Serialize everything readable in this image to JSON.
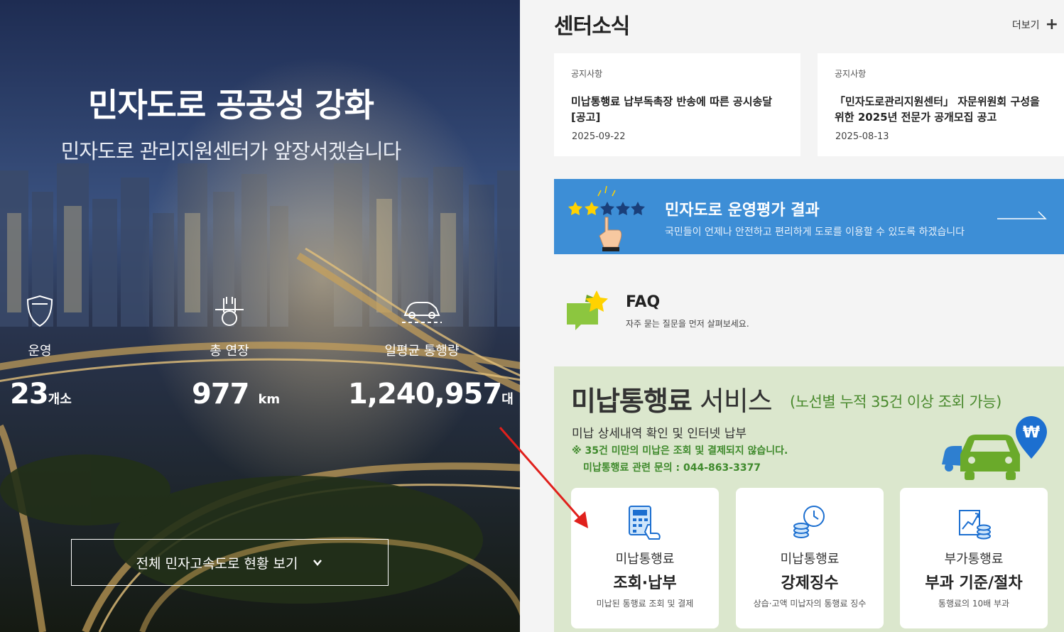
{
  "hero": {
    "title": "민자도로 공공성 강화",
    "subtitle": "민자도로 관리지원센터가 앞장서겠습니다",
    "stats": [
      {
        "icon": "shield-icon",
        "label": "운영",
        "value": "23",
        "unit": "개소"
      },
      {
        "icon": "road-icon",
        "label": "총 연장",
        "value": "977",
        "unit": "km"
      },
      {
        "icon": "car-icon",
        "label": "일평균 통행량",
        "value": "1,240,957",
        "unit": "대"
      }
    ],
    "all_button": "전체 민자고속도로 현황 보기"
  },
  "news": {
    "title": "센터소식",
    "more": "더보기",
    "items": [
      {
        "category": "공지사항",
        "title": "미납통행료 납부독촉장 반송에 따른 공시송달[공고]",
        "date": "2025-09-22"
      },
      {
        "category": "공지사항",
        "title": "「민자도로관리지원센터」 자문위원회 구성을 위한 2025년 전문가 공개모집 공고",
        "date": "2025-08-13"
      }
    ]
  },
  "evaluation": {
    "title": "민자도로 운영평가 결과",
    "subtitle": "국민들이 언제나 안전하고 편리하게 도로를 이용할 수 있도록 하겠습니다"
  },
  "faq": {
    "title": "FAQ",
    "subtitle": "자주 묻는 질문을 먼저 살펴보세요."
  },
  "service": {
    "title_bold": "미납통행료",
    "title_rest": " 서비스",
    "note": "(노선별 누적 35건 이상 조회 가능)",
    "desc": "미납 상세내역 확인 및 인터넷 납부",
    "warn1": "※ 35건 미만의 미납은 조회 및 결제되지 않습니다.",
    "warn2": "미납통행료 관련 문의 : 044-863-3377",
    "pin_symbol": "₩",
    "tiles": [
      {
        "line1": "미납통행료",
        "line2": "조회·납부",
        "line3": "미납된 통행료 조회 및 결제"
      },
      {
        "line1": "미납통행료",
        "line2": "강제징수",
        "line3": "상습·고액 미납자의 통행료 징수"
      },
      {
        "line1": "부가통행료",
        "line2": "부과 기준/절차",
        "line3": "통행료의 10배 부과"
      }
    ]
  },
  "colors": {
    "accent_blue": "#3d8ed6",
    "service_bg": "#dbe7cd",
    "green": "#4a8a2e"
  }
}
